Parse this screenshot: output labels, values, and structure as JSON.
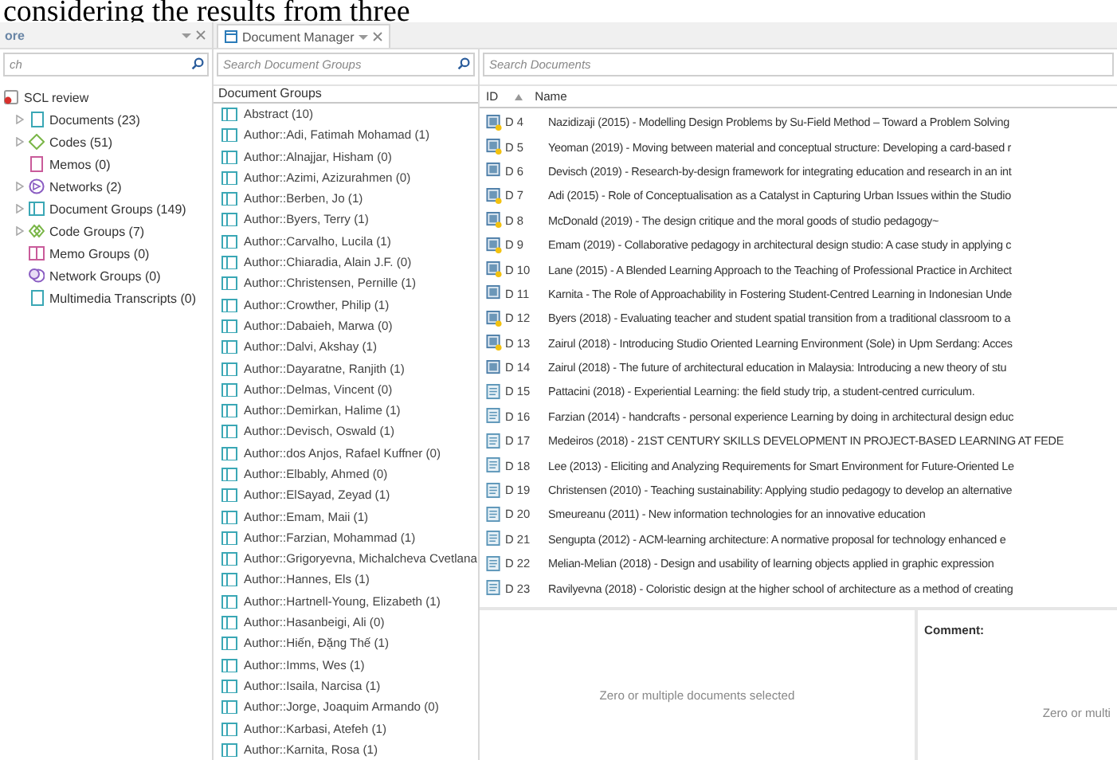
{
  "document_text": "considering the results from three",
  "explorer": {
    "title": "ore",
    "search_placeholder": "ch",
    "root": {
      "label": "SCL review",
      "children": [
        {
          "label": "Documents (23)",
          "kind": "document",
          "expandable": true
        },
        {
          "label": "Codes (51)",
          "kind": "code",
          "expandable": true
        },
        {
          "label": "Memos (0)",
          "kind": "memo",
          "expandable": false
        },
        {
          "label": "Networks (2)",
          "kind": "network",
          "expandable": true
        },
        {
          "label": "Document Groups (149)",
          "kind": "document_group",
          "expandable": true
        },
        {
          "label": "Code Groups (7)",
          "kind": "code_group",
          "expandable": true
        },
        {
          "label": "Memo Groups (0)",
          "kind": "memo_group",
          "expandable": false
        },
        {
          "label": "Network Groups (0)",
          "kind": "network_group",
          "expandable": false
        },
        {
          "label": "Multimedia Transcripts (0)",
          "kind": "document",
          "expandable": false
        }
      ]
    }
  },
  "manager": {
    "tab": "Document Manager",
    "groups_search_placeholder": "Search Document Groups",
    "groups_header": "Document Groups",
    "groups": [
      "Abstract (10)",
      "Author::Adi, Fatimah Mohamad (1)",
      "Author::Alnajjar, Hisham (0)",
      "Author::Azimi, Azizurahmen (0)",
      "Author::Berben, Jo (1)",
      "Author::Byers, Terry (1)",
      "Author::Carvalho, Lucila (1)",
      "Author::Chiaradia, Alain J.F. (0)",
      "Author::Christensen, Pernille (1)",
      "Author::Crowther, Philip (1)",
      "Author::Dabaieh, Marwa (0)",
      "Author::Dalvi, Akshay (1)",
      "Author::Dayaratne, Ranjith (1)",
      "Author::Delmas, Vincent (0)",
      "Author::Demirkan, Halime (1)",
      "Author::Devisch, Oswald (1)",
      "Author::dos Anjos, Rafael Kuffner (0)",
      "Author::Elbably, Ahmed (0)",
      "Author::ElSayad, Zeyad (1)",
      "Author::Emam, Maii (1)",
      "Author::Farzian, Mohammad (1)",
      "Author::Grigoryevna, Michalcheva Cvetlana",
      "Author::Hannes, Els (1)",
      "Author::Hartnell-Young, Elizabeth (1)",
      "Author::Hasanbeigi, Ali (0)",
      "Author::Hiến, Đặng Thế (1)",
      "Author::Imms, Wes (1)",
      "Author::Isaila, Narcisa (1)",
      "Author::Jorge, Joaquim Armando (0)",
      "Author::Karbasi, Atefeh (1)",
      "Author::Karnita, Rosa (1)"
    ],
    "documents_search_placeholder": "Search Documents",
    "columns": [
      "ID",
      "Name"
    ],
    "documents": [
      {
        "id": "D 4",
        "name": "Nazidizaji (2015) - Modelling Design Problems by Su-Field Method – Toward a Problem Solving",
        "kind": "media_memo"
      },
      {
        "id": "D 5",
        "name": "Yeoman (2019) - Moving between material and conceptual structure: Developing a card-based r",
        "kind": "media_memo"
      },
      {
        "id": "D 6",
        "name": "Devisch (2019) - Research-by-design framework for integrating education and research in an int",
        "kind": "media"
      },
      {
        "id": "D 7",
        "name": "Adi (2015) - Role of Conceptualisation as a Catalyst in Capturing Urban Issues within the Studio",
        "kind": "media_memo"
      },
      {
        "id": "D 8",
        "name": "McDonald (2019) - The design critique and the moral goods of studio pedagogy~",
        "kind": "media_memo"
      },
      {
        "id": "D 9",
        "name": "Emam (2019) - Collaborative pedagogy in architectural design studio: A case study in applying c",
        "kind": "media_memo"
      },
      {
        "id": "D 10",
        "name": "Lane (2015) - A Blended Learning Approach to the Teaching of Professional Practice in Architect",
        "kind": "media_memo"
      },
      {
        "id": "D 11",
        "name": "Karnita - The Role of Approachability in Fostering Student-Centred Learning in Indonesian Unde",
        "kind": "media"
      },
      {
        "id": "D 12",
        "name": "Byers (2018) - Evaluating teacher and student spatial transition from a traditional classroom to a",
        "kind": "media_memo"
      },
      {
        "id": "D 13",
        "name": "Zairul (2018) - Introducing Studio Oriented Learning Environment (Sole) in Upm Serdang: Acces",
        "kind": "media_memo"
      },
      {
        "id": "D 14",
        "name": "Zairul (2018) - The future of architectural education in Malaysia: Introducing a new theory of stu",
        "kind": "media"
      },
      {
        "id": "D 15",
        "name": "Pattacini (2018) - Experiential Learning: the field study trip, a student-centred curriculum.",
        "kind": "text"
      },
      {
        "id": "D 16",
        "name": "Farzian (2014) - handcrafts - personal experience Learning by doing in architectural design educ",
        "kind": "text"
      },
      {
        "id": "D 17",
        "name": "Medeiros (2018) - 21ST CENTURY SKILLS DEVELOPMENT IN PROJECT-BASED LEARNING AT FEDE",
        "kind": "text"
      },
      {
        "id": "D 18",
        "name": "Lee (2013) - Eliciting and Analyzing Requirements for Smart Environment for Future-Oriented Le",
        "kind": "text"
      },
      {
        "id": "D 19",
        "name": "Christensen (2010) - Teaching sustainability: Applying studio pedagogy to develop an alternative",
        "kind": "text"
      },
      {
        "id": "D 20",
        "name": "Smeureanu (2011) - New information technologies for an innovative education",
        "kind": "text"
      },
      {
        "id": "D 21",
        "name": "Sengupta (2012) - ACM-learning architecture: A normative proposal for technology enhanced e",
        "kind": "text"
      },
      {
        "id": "D 22",
        "name": "Melian-Melian (2018) - Design and usability of learning objects applied in graphic expression",
        "kind": "text"
      },
      {
        "id": "D 23",
        "name": "Ravilyevna (2018) - Coloristic design at the higher school of architecture as a method of creating",
        "kind": "text"
      }
    ],
    "preview": {
      "message": "Zero or multiple documents selected"
    },
    "comment": {
      "label": "Comment:",
      "message": "Zero or multi"
    }
  }
}
